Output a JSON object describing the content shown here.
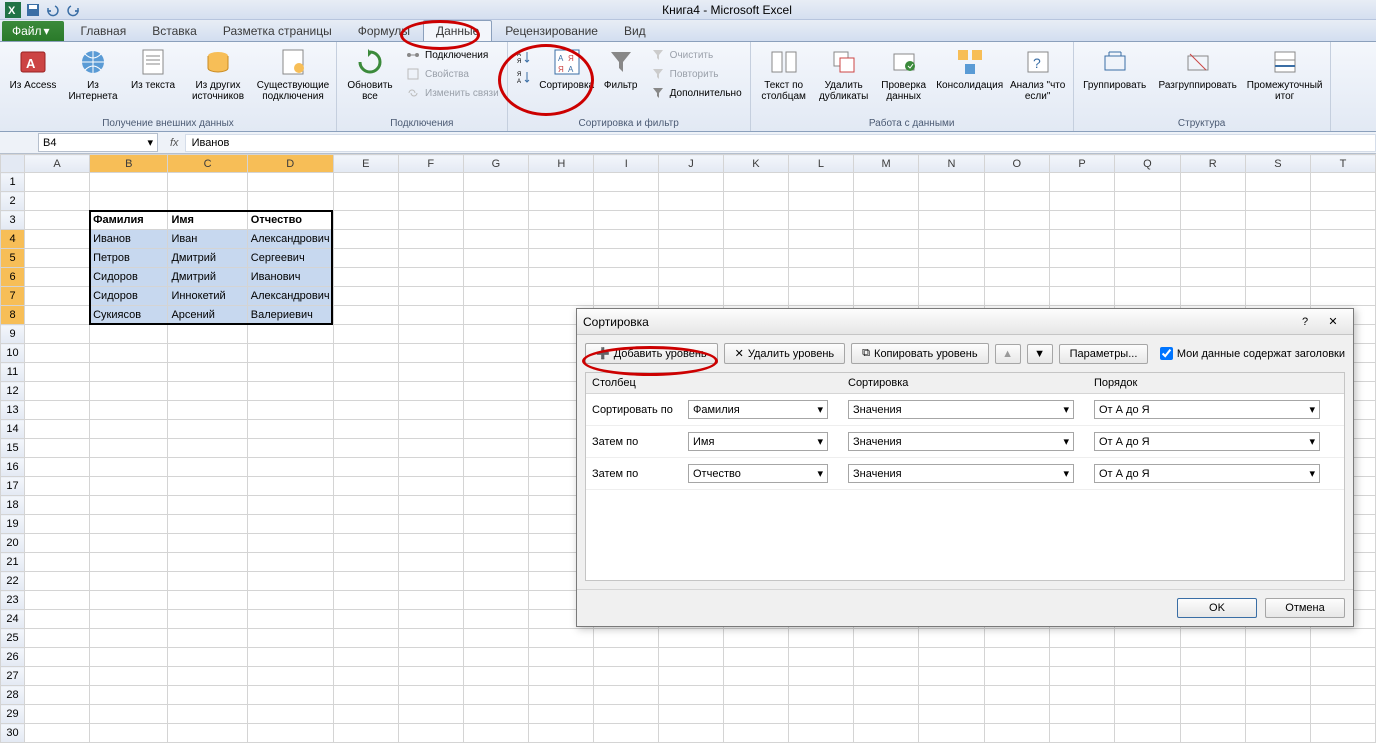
{
  "app": {
    "title": "Книга4  -  Microsoft Excel"
  },
  "tabs": {
    "file": "Файл",
    "items": [
      "Главная",
      "Вставка",
      "Разметка страницы",
      "Формулы",
      "Данные",
      "Рецензирование",
      "Вид"
    ],
    "active_index": 4
  },
  "ribbon": {
    "ext_data": {
      "access": "Из Access",
      "web": "Из Интернета",
      "text": "Из текста",
      "other": "Из других источников",
      "existing": "Существующие подключения",
      "label": "Получение внешних данных"
    },
    "connections": {
      "refresh": "Обновить все",
      "conn": "Подключения",
      "props": "Свойства",
      "links": "Изменить связи",
      "label": "Подключения"
    },
    "sortfilter": {
      "sort_az": "А↓Я",
      "sort_za": "Я↓А",
      "sort": "Сортировка",
      "filter": "Фильтр",
      "clear": "Очистить",
      "reapply": "Повторить",
      "advanced": "Дополнительно",
      "label": "Сортировка и фильтр"
    },
    "datatools": {
      "ttc": "Текст по столбцам",
      "dedup": "Удалить дубликаты",
      "validate": "Проверка данных",
      "consolidate": "Консолидация",
      "whatif": "Анализ \"что если\"",
      "label": "Работа с данными"
    },
    "outline": {
      "group": "Группировать",
      "ungroup": "Разгруппировать",
      "subtotal": "Промежуточный итог",
      "label": "Структура"
    }
  },
  "formula_bar": {
    "cell_ref": "B4",
    "value": "Иванов"
  },
  "sheet": {
    "cols": [
      "A",
      "B",
      "C",
      "D",
      "E",
      "F",
      "G",
      "H",
      "I",
      "J",
      "K",
      "L",
      "M",
      "N",
      "O",
      "P",
      "Q",
      "R",
      "S",
      "T"
    ],
    "sel_cols": [
      "B",
      "C",
      "D"
    ],
    "headers": {
      "b": "Фамилия",
      "c": "Имя",
      "d": "Отчество"
    },
    "rows": [
      {
        "n": 4,
        "b": "Иванов",
        "c": "Иван",
        "d": "Александрович"
      },
      {
        "n": 5,
        "b": "Петров",
        "c": "Дмитрий",
        "d": "Сергеевич"
      },
      {
        "n": 6,
        "b": "Сидоров",
        "c": "Дмитрий",
        "d": "Иванович"
      },
      {
        "n": 7,
        "b": "Сидоров",
        "c": "Иннокетий",
        "d": "Александрович"
      },
      {
        "n": 8,
        "b": "Сукиясов",
        "c": "Арсений",
        "d": "Валериевич"
      }
    ]
  },
  "dialog": {
    "title": "Сортировка",
    "add": "Добавить уровень",
    "del": "Удалить уровень",
    "copy": "Копировать уровень",
    "options": "Параметры...",
    "headers_chk": "Мои данные содержат заголовки",
    "col_hdr": "Столбец",
    "sort_hdr": "Сортировка",
    "order_hdr": "Порядок",
    "sort_by": "Сортировать по",
    "then_by": "Затем по",
    "levels": [
      {
        "col": "Фамилия",
        "on": "Значения",
        "order": "От А до Я"
      },
      {
        "col": "Имя",
        "on": "Значения",
        "order": "От А до Я"
      },
      {
        "col": "Отчество",
        "on": "Значения",
        "order": "От А до Я"
      }
    ],
    "ok": "OK",
    "cancel": "Отмена"
  }
}
